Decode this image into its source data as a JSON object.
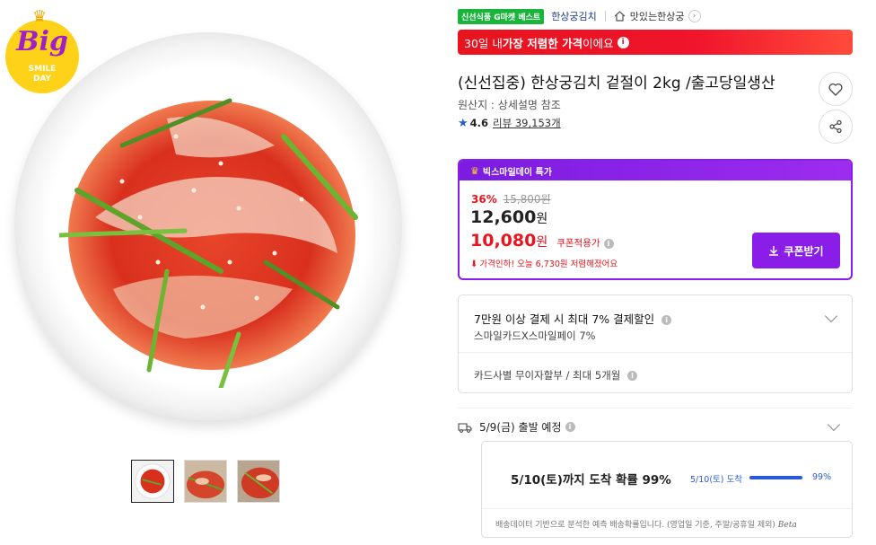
{
  "badge": {
    "big": "Big",
    "smile": "SMILE",
    "day": "DAY"
  },
  "thumbnails": [
    {
      "name": "thumb-1"
    },
    {
      "name": "thumb-2"
    },
    {
      "name": "thumb-3"
    }
  ],
  "breadcrumb": {
    "tag": "신선식품 G마켓 베스트",
    "seller": "한상궁김치",
    "store": "맛있는한상궁"
  },
  "lowest_banner": {
    "prefix": "30일 내 ",
    "highlight": "가장 저렴한 가격",
    "suffix": "이에요",
    "info_icon": "i"
  },
  "product": {
    "title": "(신선집중) 한상궁김치 겉절이 2kg /출고당일생산",
    "origin": "원산지 : 상세설명 참조",
    "rating": "4.6",
    "review_label": "리뷰 39,153개"
  },
  "deal": {
    "header": "빅스마일데이 특가",
    "discount_pct": "36%",
    "original_price": "15,800원",
    "price_num": "12,600",
    "price_unit": "원",
    "coupon_price_num": "10,080",
    "coupon_price_unit": "원",
    "coupon_label": "쿠폰적용가",
    "price_drop": "가격인하! 오늘 6,730원 저렴해졌어요",
    "coupon_button": "쿠폰받기"
  },
  "payment": {
    "line1": "7만원 이상 결제 시 최대 7% 결제할인",
    "line1_sub": "스마일카드X스마일페이 7%",
    "line2": "카드사별 무이자할부 / 최대 5개월"
  },
  "shipping": {
    "title": "5/9(금) 출발 예정",
    "prediction": "5/10(토)까지 도착 확률 99%",
    "arrival_label": "5/10(토) 도착",
    "probability": 0.99,
    "probability_label": "99%",
    "note": "배송데이터 기반으로 분석한 예측 배송확률입니다. (영업일 기준, 주말/공휴일 제외)",
    "beta": "Beta"
  },
  "colors": {
    "accent_purple": "#8a1ee8",
    "sale_red": "#e8141e",
    "link_blue": "#2a5bd7",
    "tag_green": "#18b53a"
  },
  "icons": [
    "crown-icon",
    "home-icon",
    "chevron-right-icon",
    "info-icon",
    "heart-icon",
    "share-icon",
    "star-icon",
    "download-icon",
    "chevron-down-icon",
    "truck-icon",
    "price-drop-icon"
  ]
}
